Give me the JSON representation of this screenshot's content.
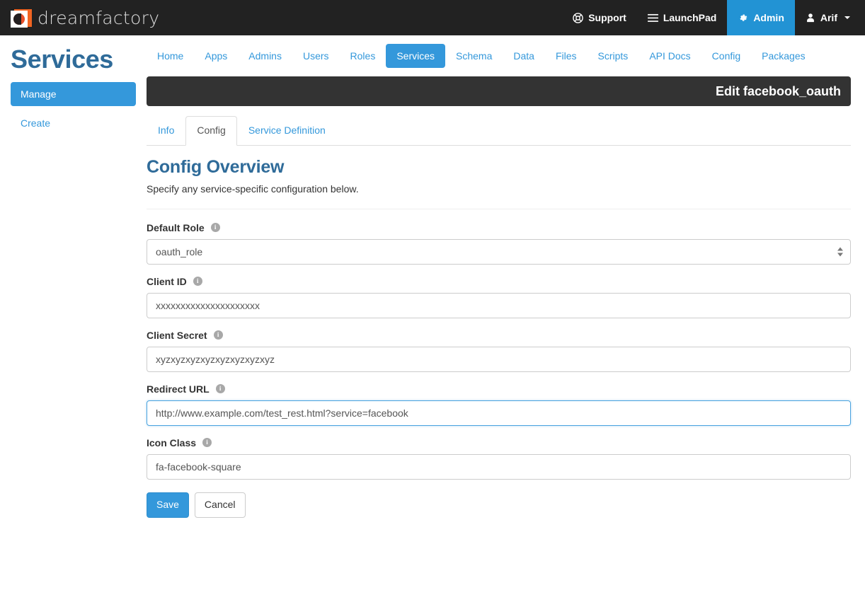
{
  "topbar": {
    "brand_name": "dreamfactory",
    "brand_logo_icon": "dreamfactory-logo-icon",
    "items": [
      {
        "label": "Support",
        "icon": "lifebuoy-icon",
        "active": false
      },
      {
        "label": "LaunchPad",
        "icon": "hamburger-icon",
        "active": false
      },
      {
        "label": "Admin",
        "icon": "gear-icon",
        "active": true
      },
      {
        "label": "Arif",
        "icon": "user-icon",
        "active": false,
        "caret": "chevron-down-icon"
      }
    ]
  },
  "sidebar": {
    "title": "Services",
    "items": [
      {
        "label": "Manage",
        "active": true
      },
      {
        "label": "Create",
        "active": false
      }
    ]
  },
  "navtabs": [
    {
      "label": "Home",
      "active": false
    },
    {
      "label": "Apps",
      "active": false
    },
    {
      "label": "Admins",
      "active": false
    },
    {
      "label": "Users",
      "active": false
    },
    {
      "label": "Roles",
      "active": false
    },
    {
      "label": "Services",
      "active": true
    },
    {
      "label": "Schema",
      "active": false
    },
    {
      "label": "Data",
      "active": false
    },
    {
      "label": "Files",
      "active": false
    },
    {
      "label": "Scripts",
      "active": false
    },
    {
      "label": "API Docs",
      "active": false
    },
    {
      "label": "Config",
      "active": false
    },
    {
      "label": "Packages",
      "active": false
    }
  ],
  "titlebar": {
    "text": "Edit facebook_oauth"
  },
  "subtabs": [
    {
      "label": "Info",
      "active": false
    },
    {
      "label": "Config",
      "active": true
    },
    {
      "label": "Service Definition",
      "active": false
    }
  ],
  "form": {
    "heading": "Config Overview",
    "subheading": "Specify any service-specific configuration below.",
    "fields": [
      {
        "label": "Default Role",
        "value": "oauth_role",
        "type": "select",
        "info_icon": "info-icon",
        "focused": false
      },
      {
        "label": "Client ID",
        "value": "xxxxxxxxxxxxxxxxxxxxx",
        "type": "text",
        "info_icon": "info-icon",
        "focused": false
      },
      {
        "label": "Client Secret",
        "value": "xyzxyzxyzxyzxyzxyzxyzxyz",
        "type": "text",
        "info_icon": "info-icon",
        "focused": false
      },
      {
        "label": "Redirect URL",
        "value": "http://www.example.com/test_rest.html?service=facebook",
        "type": "text",
        "info_icon": "info-icon",
        "focused": true
      },
      {
        "label": "Icon Class",
        "value": "fa-facebook-square",
        "type": "text",
        "info_icon": "info-icon",
        "focused": false
      }
    ],
    "buttons": [
      {
        "label": "Save",
        "style": "primary"
      },
      {
        "label": "Cancel",
        "style": "default"
      }
    ]
  },
  "colors": {
    "accent_blue": "#3498db",
    "dark_navbar": "#222222",
    "dark_titlebar": "#333333",
    "heading_blue": "#2f6b99",
    "logo_orange": "#e8502a"
  }
}
